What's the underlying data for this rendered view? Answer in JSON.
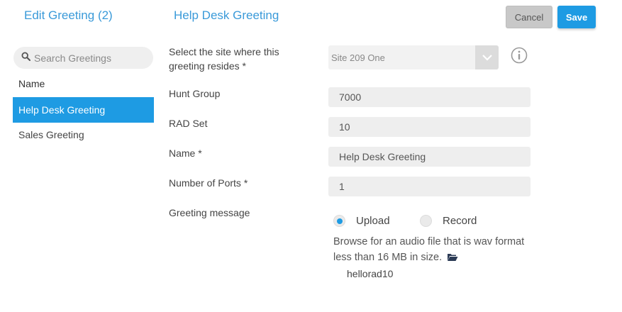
{
  "left_panel": {
    "title": "Edit Greeting (2)",
    "search_placeholder": "Search Greetings",
    "list_header": "Name",
    "items": [
      {
        "label": "Help Desk Greeting",
        "active": true
      },
      {
        "label": "Sales Greeting",
        "active": false
      }
    ]
  },
  "main": {
    "title": "Help Desk Greeting"
  },
  "toolbar": {
    "cancel_label": "Cancel",
    "save_label": "Save"
  },
  "form": {
    "site_label_line1": "Select the site where this",
    "site_label_line2": "greeting resides  *",
    "site_value": "Site 209 One",
    "hunt_group_label": "Hunt Group",
    "hunt_group_value": "7000",
    "rad_set_label": "RAD Set",
    "rad_set_value": "10",
    "name_label": "Name  *",
    "name_value": "Help Desk Greeting",
    "ports_label": "Number of Ports  *",
    "ports_value": "1",
    "greeting_label": "Greeting message",
    "upload_label": "Upload",
    "record_label": "Record",
    "upload_selected": true,
    "browse_text": "Browse for an audio file that is wav format less than 16 MB in size.",
    "file_name": "hellorad10"
  },
  "icons": {
    "search": "search-icon",
    "dropdown": "chevron-down-icon",
    "info": "info-icon",
    "folder": "folder-open-icon"
  },
  "colors": {
    "accent": "#1e9be3",
    "title": "#3a9ad9"
  }
}
